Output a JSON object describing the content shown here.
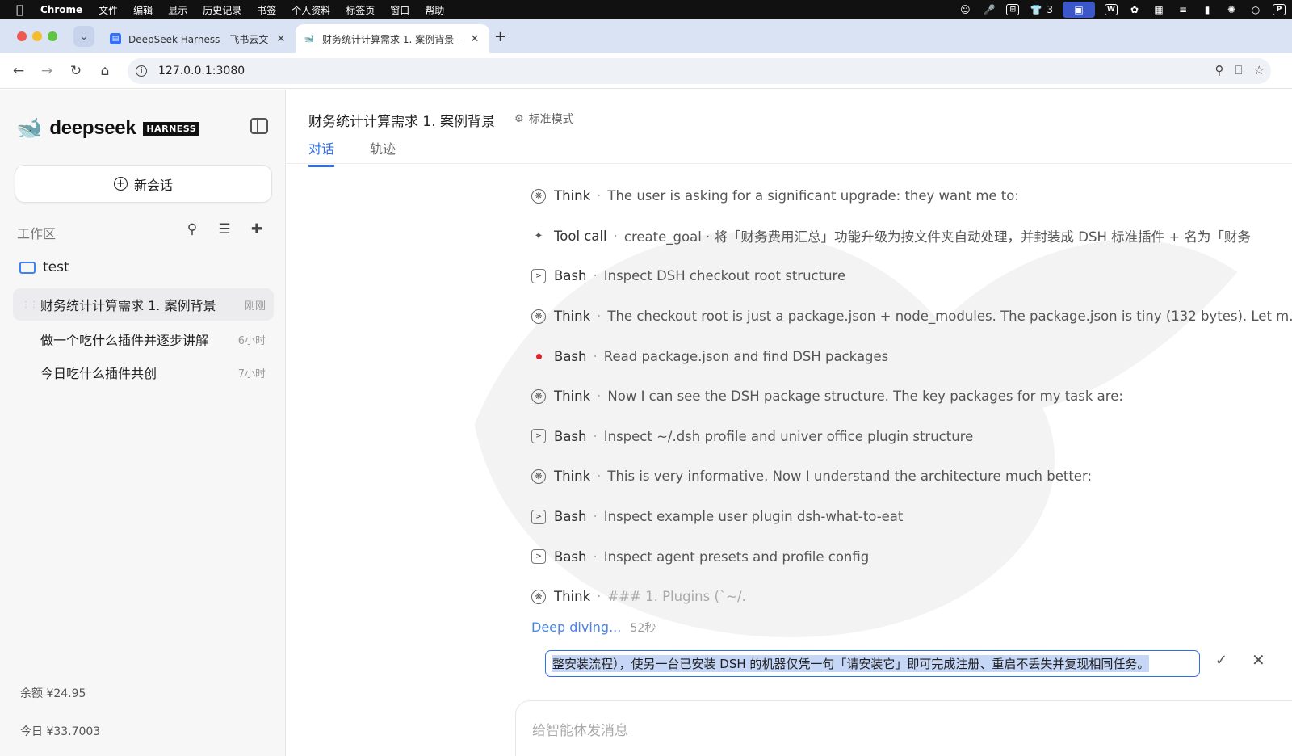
{
  "menubar": {
    "app": "Chrome",
    "items": [
      "文件",
      "编辑",
      "显示",
      "历史记录",
      "书签",
      "个人资料",
      "标签页",
      "窗口",
      "帮助"
    ],
    "tray_count": "3"
  },
  "browser": {
    "tabs": [
      {
        "title": "DeepSeek Harness - 飞书云文",
        "active": false
      },
      {
        "title": "财务统计计算需求 1. 案例背景 -",
        "active": true
      }
    ],
    "url": "127.0.0.1:3080"
  },
  "sidebar": {
    "brand": "deepseek",
    "brand_badge": "HARNESS",
    "new_chat": "新会话",
    "workspace_label": "工作区",
    "folder": "test",
    "conversations": [
      {
        "title": "财务统计计算需求 1. 案例背景",
        "time": "刚刚",
        "active": true
      },
      {
        "title": "做一个吃什么插件并逐步讲解",
        "time": "6小时",
        "active": false
      },
      {
        "title": "今日吃什么插件共创",
        "time": "7小时",
        "active": false
      }
    ],
    "balance": "余额 ¥24.95",
    "today": "今日 ¥33.7003"
  },
  "main": {
    "title": "财务统计计算需求 1. 案例背景",
    "mode": "标准模式",
    "tabs": [
      "对话",
      "轨迹"
    ],
    "steps": [
      {
        "icon": "think-icon",
        "kind": "Think",
        "detail": "The user is asking for a significant upgrade: they want me to:"
      },
      {
        "icon": "sparkle-icon",
        "kind": "Tool call",
        "detail": "create_goal · 将「财务费用汇总」功能升级为按文件夹自动处理，并封装成 DSH 标准插件 + 名为「财务"
      },
      {
        "icon": "terminal-icon",
        "kind": "Bash",
        "detail": "Inspect DSH checkout root structure"
      },
      {
        "icon": "think-icon",
        "kind": "Think",
        "detail": "The checkout root is just a package.json + node_modules. The package.json is tiny (132 bytes). Let m..."
      },
      {
        "icon": "running-dot-icon",
        "kind": "Bash",
        "detail": "Read package.json and find DSH packages"
      },
      {
        "icon": "think-icon",
        "kind": "Think",
        "detail": "Now I can see the DSH package structure. The key packages for my task are:"
      },
      {
        "icon": "terminal-icon",
        "kind": "Bash",
        "detail": "Inspect ~/.dsh profile and univer office plugin structure"
      },
      {
        "icon": "think-icon",
        "kind": "Think",
        "detail": "This is very informative. Now I understand the architecture much better:"
      },
      {
        "icon": "terminal-icon",
        "kind": "Bash",
        "detail": "Inspect example user plugin dsh-what-to-eat"
      },
      {
        "icon": "terminal-icon",
        "kind": "Bash",
        "detail": "Inspect agent presets and profile config"
      },
      {
        "icon": "think-icon",
        "kind": "Think",
        "detail": "### 1. Plugins (`~/."
      }
    ],
    "status": "Deep diving...",
    "status_time": "52秒",
    "goal_edit_value": "整安装流程），使另一台已安装 DSH 的机器仅凭一句「请安装它」即可完成注册、重启不丢失并复现相同任务。",
    "composer_placeholder": "给智能体发消息"
  },
  "colors": {
    "accent": "#2f6fed",
    "running": "#e0202a",
    "selection": "#c5d6f6"
  }
}
